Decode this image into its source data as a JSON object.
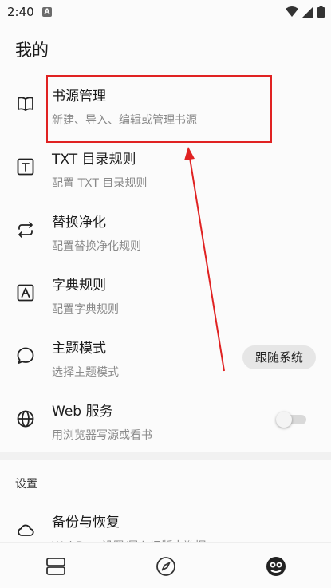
{
  "status_bar": {
    "time": "2:40",
    "notification_glyph": "A",
    "icons": [
      "wifi-icon",
      "signal-icon",
      "battery-icon"
    ]
  },
  "page": {
    "title": "我的"
  },
  "menu": [
    {
      "id": "book-source",
      "icon": "book-open-icon",
      "title": "书源管理",
      "subtitle": "新建、导入、编辑或管理书源"
    },
    {
      "id": "txt-toc",
      "icon": "txt-icon",
      "title": "TXT 目录规则",
      "subtitle": "配置 TXT 目录规则"
    },
    {
      "id": "replace",
      "icon": "swap-arrows-icon",
      "title": "替换净化",
      "subtitle": "配置替换净化规则"
    },
    {
      "id": "dict",
      "icon": "letter-a-icon",
      "title": "字典规则",
      "subtitle": "配置字典规则"
    },
    {
      "id": "theme",
      "icon": "theme-bubble-icon",
      "title": "主题模式",
      "subtitle": "选择主题模式",
      "value": "跟随系统"
    },
    {
      "id": "web",
      "icon": "globe-icon",
      "title": "Web 服务",
      "subtitle": "用浏览器写源或看书",
      "toggle_on": false
    }
  ],
  "settings_section": {
    "header": "设置",
    "items": [
      {
        "id": "backup",
        "icon": "cloud-icon",
        "title": "备份与恢复",
        "subtitle": "WebDav 设置/导入旧版本数据"
      }
    ]
  },
  "bottom_nav": {
    "items": [
      "bookshelf-icon",
      "compass-icon",
      "profile-icon"
    ]
  },
  "annotation": {
    "color": "#e02222"
  }
}
